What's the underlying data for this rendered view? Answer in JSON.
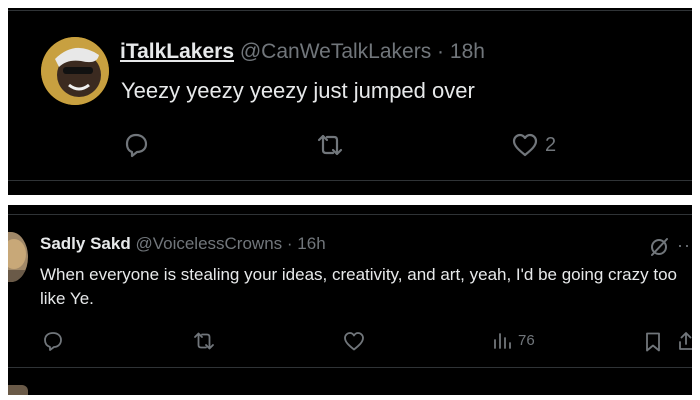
{
  "tweets": [
    {
      "display_name": "iTalkLakers",
      "handle": "@CanWeTalkLakers",
      "separator": "·",
      "time": "18h",
      "text": "Yeezy yeezy yeezy just jumped over",
      "like_count": "2"
    },
    {
      "display_name": "Sadly Sakd",
      "handle": "@VoicelessCrowns",
      "separator": "·",
      "time": "16h",
      "text": "When everyone is stealing your ideas, creativity, and art, yeah, I'd be going crazy too like Ye.",
      "view_count": "76",
      "more_label": "···"
    }
  ],
  "colors": {
    "background": "#000000",
    "text_primary": "#e7e9ea",
    "text_secondary": "#71767b",
    "divider": "#2f3336"
  },
  "icons": [
    "reply-icon",
    "retweet-icon",
    "like-icon",
    "views-icon",
    "bookmark-icon",
    "share-icon",
    "grok-icon",
    "more-icon"
  ]
}
